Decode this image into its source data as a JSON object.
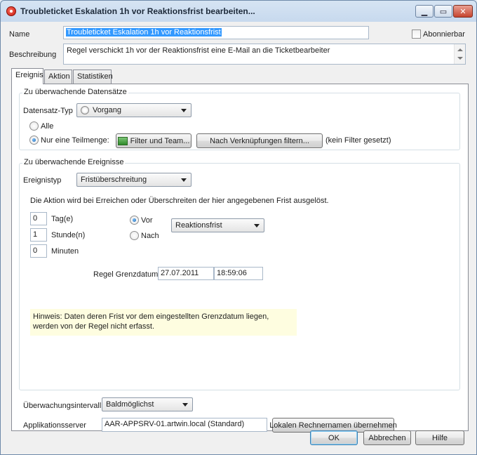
{
  "window": {
    "title": "Troubleticket Eskalation 1h vor Reaktionsfrist bearbeiten...",
    "minimize_glyph": "▁",
    "maximize_glyph": "▭",
    "close_glyph": "✕"
  },
  "header": {
    "name_label": "Name",
    "name_value": "Troubleticket Eskalation 1h vor Reaktionsfrist",
    "subscribe_label": "Abonnierbar",
    "description_label": "Beschreibung",
    "description_value": "Regel verschickt 1h vor der Reaktionsfrist eine E-Mail an die Ticketbearbeiter"
  },
  "tabs": [
    {
      "label": "Ereignis",
      "active": true
    },
    {
      "label": "Aktion",
      "active": false
    },
    {
      "label": "Statistiken",
      "active": false
    }
  ],
  "records": {
    "group_title": "Zu überwachende Datensätze",
    "type_label": "Datensatz-Typ",
    "type_value": "Vorgang",
    "all_label": "Alle",
    "subset_label": "Nur eine Teilmenge:",
    "filter_button": "Filter und Team...",
    "link_filter_button": "Nach Verknüpfungen filtern...",
    "filter_status": "(kein Filter gesetzt)"
  },
  "events": {
    "group_title": "Zu überwachende Ereignisse",
    "type_label": "Ereignistyp",
    "type_value": "Fristüberschreitung",
    "info_text": "Die Aktion wird bei Erreichen oder Überschreiten der hier angegebenen Frist ausgelöst.",
    "days_value": "0",
    "days_label": "Tag(e)",
    "hours_value": "1",
    "hours_label": "Stunde(n)",
    "minutes_value": "0",
    "minutes_label": "Minuten",
    "before_label": "Vor",
    "after_label": "Nach",
    "deadline_value": "Reaktionsfrist",
    "limit_label": "Regel Grenzdatum",
    "limit_date": "27.07.2011",
    "limit_time": "18:59:06",
    "hint_text": "Hinweis:  Daten deren Frist vor dem eingestellten Grenzdatum liegen, werden von der Regel nicht erfasst."
  },
  "monitoring": {
    "interval_label": "Überwachungsintervall",
    "interval_value": "Baldmöglichst",
    "server_label": "Applikationsserver",
    "server_value": "AAR-APPSRV-01.artwin.local (Standard)",
    "server_button": "Lokalen Rechnernamen übernehmen"
  },
  "footer": {
    "ok": "OK",
    "cancel": "Abbrechen",
    "help": "Hilfe"
  }
}
